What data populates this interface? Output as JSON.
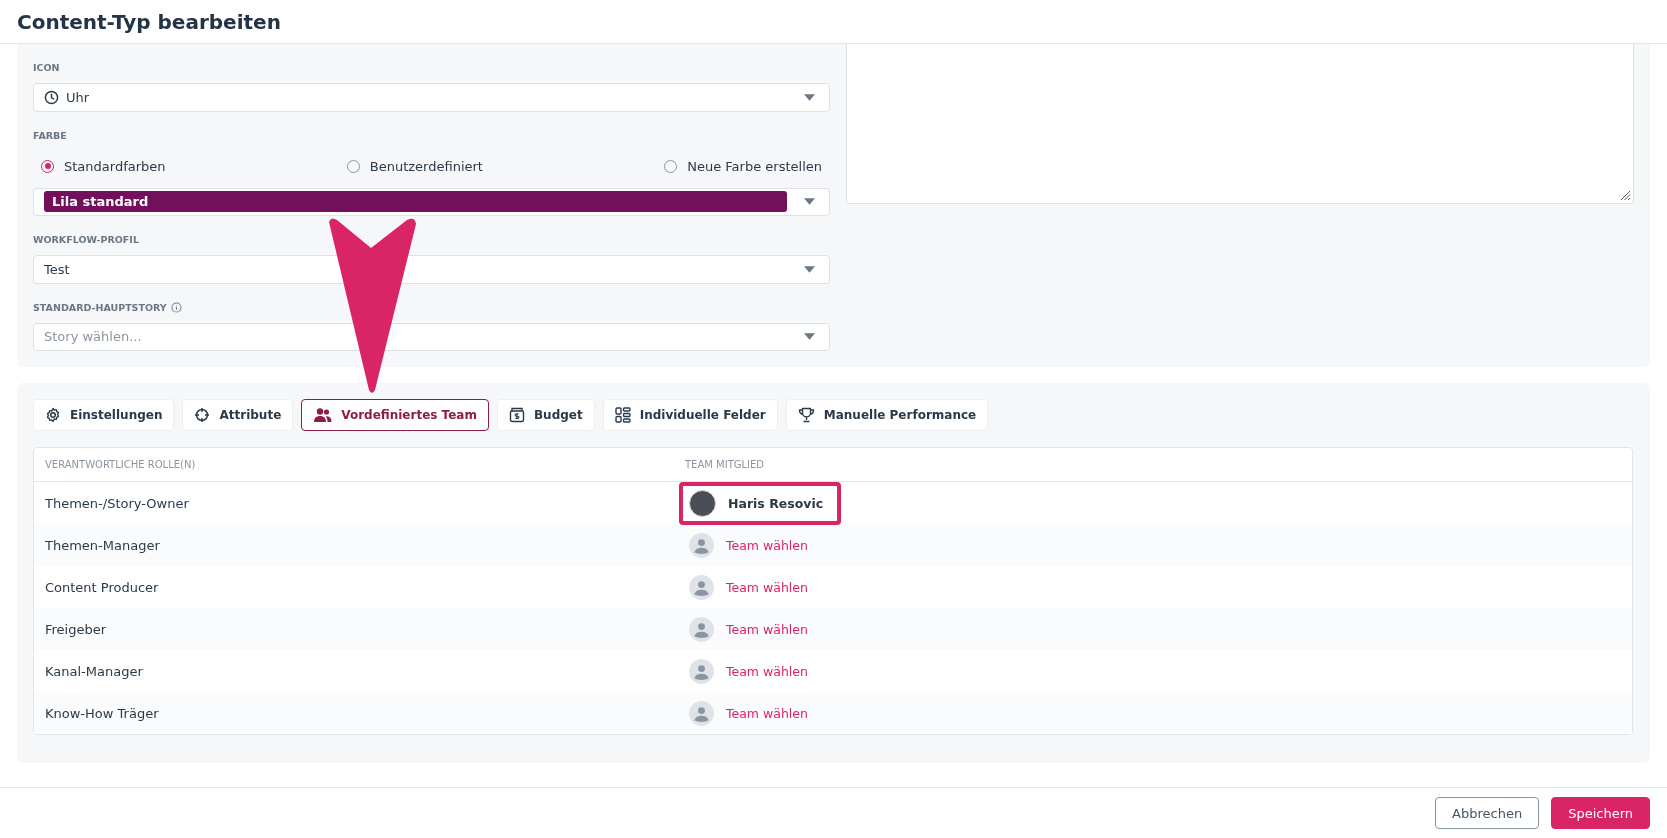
{
  "header": {
    "title": "Content-Typ bearbeiten"
  },
  "icon_field": {
    "label": "ICON",
    "value": "Uhr"
  },
  "color_field": {
    "label": "FARBE",
    "options": [
      {
        "label": "Standardfarben",
        "selected": true
      },
      {
        "label": "Benutzerdefiniert",
        "selected": false
      },
      {
        "label": "Neue Farbe erstellen",
        "selected": false
      }
    ],
    "value": "Lila standard",
    "color": "#72105c"
  },
  "workflow_field": {
    "label": "WORKFLOW-PROFIL",
    "value": "Test"
  },
  "story_field": {
    "label": "STANDARD-HAUPTSTORY",
    "placeholder": "Story wählen..."
  },
  "tabs": [
    {
      "label": "Einstellungen",
      "kind": "gear",
      "selected": false
    },
    {
      "label": "Attribute",
      "kind": "crosshair",
      "selected": false
    },
    {
      "label": "Vordefiniertes Team",
      "kind": "users",
      "selected": true
    },
    {
      "label": "Budget",
      "kind": "budget",
      "selected": false
    },
    {
      "label": "Individuelle Felder",
      "kind": "fields",
      "selected": false
    },
    {
      "label": "Manuelle Performance",
      "kind": "trophy",
      "selected": false
    }
  ],
  "table": {
    "columns": [
      "VERANTWORTLICHE ROLLE(N)",
      "TEAM MITGLIED"
    ],
    "rows": [
      {
        "role": "Themen-/Story-Owner",
        "member": "Haris Resovic",
        "kind": "person",
        "highlighted": true
      },
      {
        "role": "Themen-Manager",
        "member": "Team wählen",
        "kind": "empty",
        "highlighted": false
      },
      {
        "role": "Content Producer",
        "member": "Team wählen",
        "kind": "empty",
        "highlighted": false
      },
      {
        "role": "Freigeber",
        "member": "Team wählen",
        "kind": "empty",
        "highlighted": false
      },
      {
        "role": "Kanal-Manager",
        "member": "Team wählen",
        "kind": "empty",
        "highlighted": false
      },
      {
        "role": "Know-How Träger",
        "member": "Team wählen",
        "kind": "empty",
        "highlighted": false
      }
    ]
  },
  "buttons": [
    {
      "label": "Abbrechen",
      "kind": "secondary"
    },
    {
      "label": "Speichern",
      "kind": "primary"
    }
  ],
  "annotation_arrow": true
}
